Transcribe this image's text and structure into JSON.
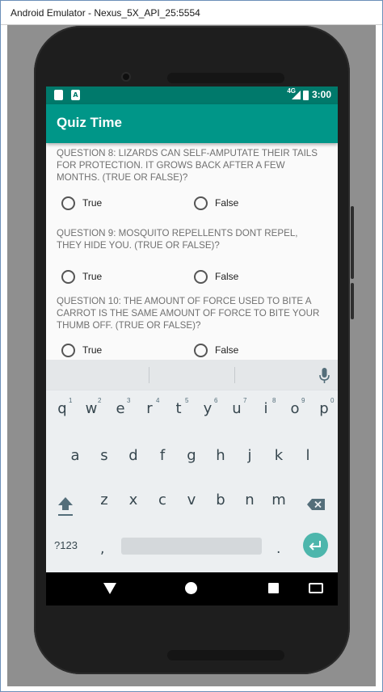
{
  "window": {
    "title": "Android Emulator - Nexus_5X_API_25:5554"
  },
  "status_bar": {
    "time": "3:00",
    "network": "4G",
    "colors": {
      "background": "#00796b"
    }
  },
  "app": {
    "title": "Quiz Time",
    "colors": {
      "app_bar": "#009688",
      "accent": "#4db6ac"
    }
  },
  "questions": [
    {
      "text": "QUESTION 8: LIZARDS CAN SELF-AMPUTATE THEIR TAILS FOR PROTECTION. IT GROWS BACK AFTER A FEW MONTHS. (TRUE OR FALSE)?",
      "options": [
        "True",
        "False"
      ]
    },
    {
      "text": "QUESTION 9: MOSQUITO REPELLENTS DONT REPEL, THEY HIDE YOU. (TRUE OR FALSE)?",
      "options": [
        "True",
        "False"
      ]
    },
    {
      "text": "QUESTION 10: THE AMOUNT OF FORCE USED TO BITE A CARROT IS THE SAME AMOUNT OF FORCE TO BITE YOUR THUMB OFF. (TRUE OR FALSE)?",
      "options": [
        "True",
        "False"
      ]
    }
  ],
  "keyboard": {
    "row1": [
      "q",
      "w",
      "e",
      "r",
      "t",
      "y",
      "u",
      "i",
      "o",
      "p"
    ],
    "row1_numbers": [
      "1",
      "2",
      "3",
      "4",
      "5",
      "6",
      "7",
      "8",
      "9",
      "0"
    ],
    "row2": [
      "a",
      "s",
      "d",
      "f",
      "g",
      "h",
      "j",
      "k",
      "l"
    ],
    "row3": [
      "z",
      "x",
      "c",
      "v",
      "b",
      "n",
      "m"
    ],
    "symbols_key": "?123",
    "comma_key": ",",
    "period_key": "."
  }
}
